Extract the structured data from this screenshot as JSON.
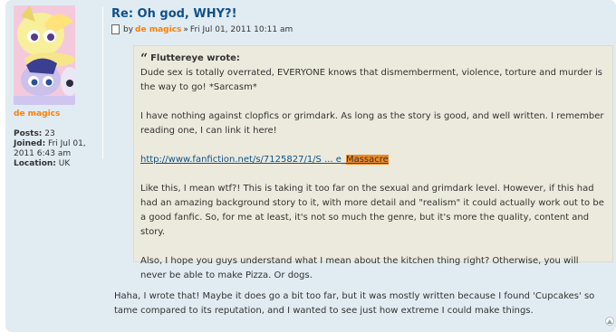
{
  "post": {
    "title": "Re: Oh god, WHY?!",
    "meta_by": "by",
    "author": "de magics",
    "meta_sep": "»",
    "date": "Fri Jul 01, 2011 10:11 am"
  },
  "profile": {
    "username": "de magics",
    "posts_label": "Posts:",
    "posts_value": "23",
    "joined_label": "Joined:",
    "joined_value": "Fri Jul 01, 2011 6:43 am",
    "location_label": "Location:",
    "location_value": "UK"
  },
  "quote": {
    "cite": "Fluttereye wrote:",
    "p1": "Dude sex is totally overrated, EVERYONE knows that dismemberment, violence, torture and murder is the way to go! *Sarcasm*",
    "p2": "I have nothing against clopfics or grimdark. As long as the story is good, and well written. I remember reading one, I can link it here!",
    "link_text": "http://www.fanfiction.net/s/7125827/1/S ... e_",
    "link_highlight": "Massacre",
    "p3": "Like this, I mean wtf?! This is taking it too far on the sexual and grimdark level. However, if this had had an amazing background story to it, with more detail and \"realism\" it could actually work out to be a good fanfic. So, for me at least, it's not so much the genre, but it's more the quality, content and story.",
    "p4": "Also, I hope you guys understand what I mean about the kitchen thing right? Otherwise, you will never be able to make Pizza. Or dogs."
  },
  "reply": "Haha, I wrote that! Maybe it does go a bit too far, but it was mostly written because I found 'Cupcakes' so tame compared to its reputation, and I wanted to see just how extreme I could make things.",
  "icons": {
    "quote_mark": "quote-icon",
    "doc": "post-icon",
    "top": "back-to-top-icon"
  }
}
